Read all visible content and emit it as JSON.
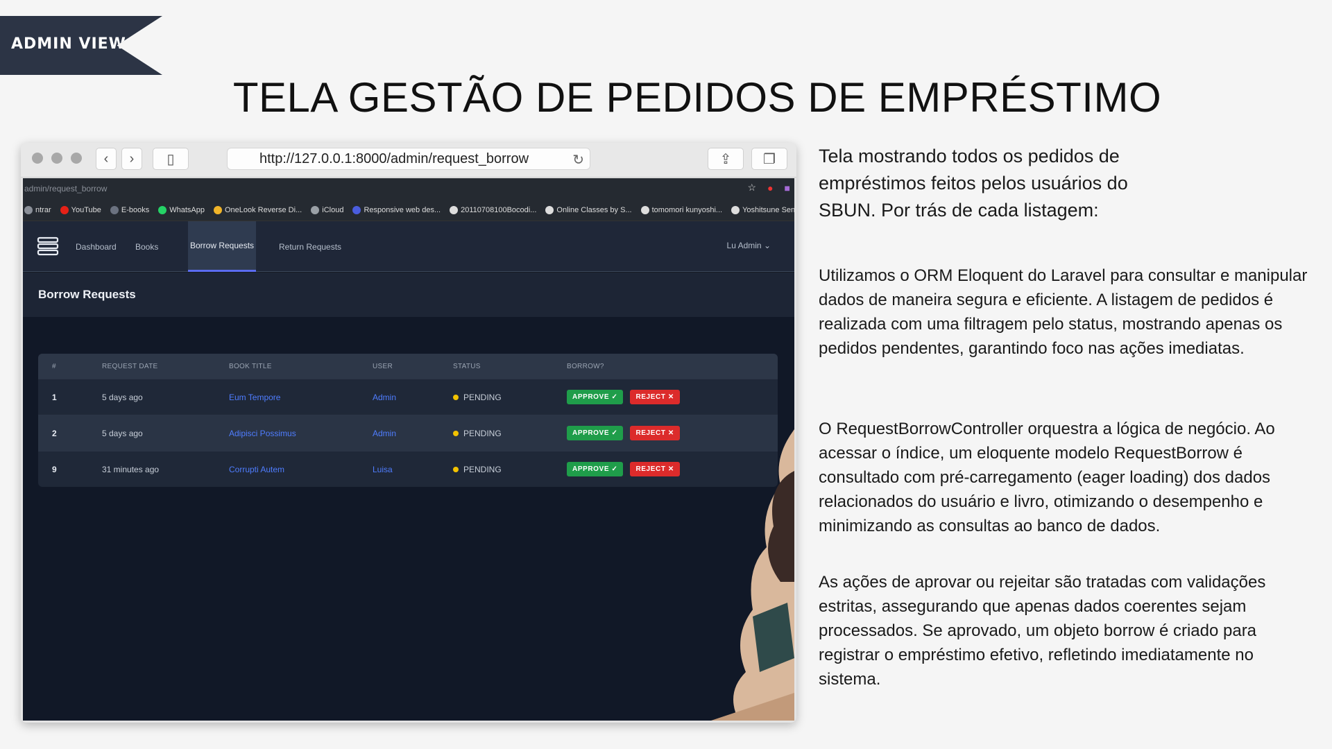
{
  "ribbon": {
    "label": "ADMIN VIEW"
  },
  "slide_title": "TELA GESTÃO DE PEDIDOS DE EMPRÉSTIMO",
  "browser": {
    "url": "http://127.0.0.1:8000/admin/request_borrow",
    "addr_partial": "admin/request_borrow",
    "bookmarks": [
      {
        "label": "ntrar",
        "icon": "page-icon",
        "color": "#8a8f98"
      },
      {
        "label": "YouTube",
        "icon": "youtube-icon",
        "color": "#e62117"
      },
      {
        "label": "E-books",
        "icon": "books-icon",
        "color": "#6b7280"
      },
      {
        "label": "WhatsApp",
        "icon": "whatsapp-icon",
        "color": "#25d366"
      },
      {
        "label": "OneLook Reverse Di...",
        "icon": "sun-icon",
        "color": "#f0b429"
      },
      {
        "label": "iCloud",
        "icon": "apple-icon",
        "color": "#9aa0a6"
      },
      {
        "label": "Responsive web des...",
        "icon": "w-icon",
        "color": "#4a5dde"
      },
      {
        "label": "20110708100Bocodi...",
        "icon": "globe-icon",
        "color": "#ddd"
      },
      {
        "label": "Online Classes by S...",
        "icon": "globe-icon",
        "color": "#ddd"
      },
      {
        "label": "tomomori kunyoshi...",
        "icon": "google-icon",
        "color": "#ddd"
      },
      {
        "label": "Yoshitsune Senbon...",
        "icon": "wikipedia-icon",
        "color": "#ddd"
      }
    ]
  },
  "app": {
    "nav": {
      "dashboard": "Dashboard",
      "books": "Books",
      "borrow_requests": "Borrow Requests",
      "return_requests": "Return Requests",
      "user": "Lu Admin"
    },
    "page_title": "Borrow Requests",
    "table": {
      "headers": [
        "#",
        "REQUEST DATE",
        "BOOK TITLE",
        "USER",
        "STATUS",
        "BORROW?"
      ],
      "rows": [
        {
          "id": "1",
          "date": "5 days ago",
          "title": "Eum Tempore",
          "user": "Admin",
          "status": "PENDING"
        },
        {
          "id": "2",
          "date": "5 days ago",
          "title": "Adipisci Possimus",
          "user": "Admin",
          "status": "PENDING"
        },
        {
          "id": "9",
          "date": "31 minutes ago",
          "title": "Corrupti Autem",
          "user": "Luisa",
          "status": "PENDING"
        }
      ],
      "approve_label": "APPROVE ✓",
      "reject_label": "REJECT ✕"
    }
  },
  "text": {
    "intro": "Tela mostrando todos os pedidos de empréstimos feitos pelos usuários do SBUN. Por trás de cada listagem:",
    "p1": "Utilizamos o ORM Eloquent do Laravel para consultar e manipular dados de maneira segura e eficiente. A listagem de pedidos é realizada com uma filtragem pelo status, mostrando apenas os pedidos pendentes, garantindo foco nas ações imediatas.",
    "p2": "O RequestBorrowController orquestra a lógica de negócio. Ao acessar o índice, um eloquente modelo RequestBorrow é consultado com pré-carregamento (eager loading) dos dados relacionados do usuário e livro, otimizando o desempenho e minimizando as consultas ao banco de dados.",
    "p3": "As ações de aprovar ou rejeitar são tratadas com validações estritas, assegurando que apenas dados coerentes sejam processados. Se aprovado, um objeto borrow é criado para registrar o empréstimo efetivo, refletindo imediatamente no sistema."
  }
}
